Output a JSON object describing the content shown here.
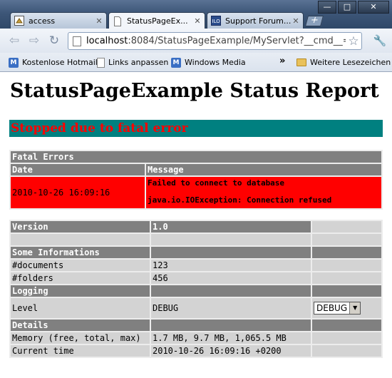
{
  "browser": {
    "tabs": [
      {
        "label": "access",
        "icon": "java-applet-icon",
        "active": false
      },
      {
        "label": "StatusPageEx...",
        "icon": "blank-page-icon",
        "active": true
      },
      {
        "label": "Support Forum...",
        "icon": "ilo-icon",
        "active": false
      }
    ],
    "url_host": "localhost",
    "url_rest": ":8084/StatusPageExample/MyServlet?__cmd__=s",
    "bookmarks": [
      {
        "label": "Kostenlose Hotmail",
        "icon": "msn-icon"
      },
      {
        "label": "Links anpassen",
        "icon": "blank-page-icon"
      },
      {
        "label": "Windows Media",
        "icon": "msn-icon"
      }
    ],
    "bookmarks_overflow": "»",
    "other_bookmarks": "Weitere Lesezeichen",
    "window_buttons": {
      "minimize": "—",
      "maximize": "□",
      "close": "✕"
    }
  },
  "page": {
    "title": "StatusPageExample Status Report",
    "status": "Stopped due to fatal error",
    "status_bg": "#008080",
    "status_color": "#ff0000",
    "fatal_errors": {
      "heading": "Fatal Errors",
      "columns": [
        "Date",
        "Message"
      ],
      "rows": [
        {
          "date": "2010-10-26 16:09:16",
          "message": "Failed to connect to database",
          "exception": "java.io.IOException: Connection refused"
        }
      ]
    },
    "info": {
      "version_label": "Version",
      "version_value": "1.0",
      "some_info_heading": "Some Informations",
      "documents_label": "#documents",
      "documents_value": "123",
      "folders_label": "#folders",
      "folders_value": "456",
      "logging_heading": "Logging",
      "level_label": "Level",
      "level_value": "DEBUG",
      "level_select_value": "DEBUG",
      "details_heading": "Details",
      "memory_label": "Memory (free, total, max)",
      "memory_value": "1.7 MB, 9.7 MB, 1,065.5 MB",
      "time_label": "Current time",
      "time_value": "2010-10-26 16:09:16 +0200"
    }
  }
}
